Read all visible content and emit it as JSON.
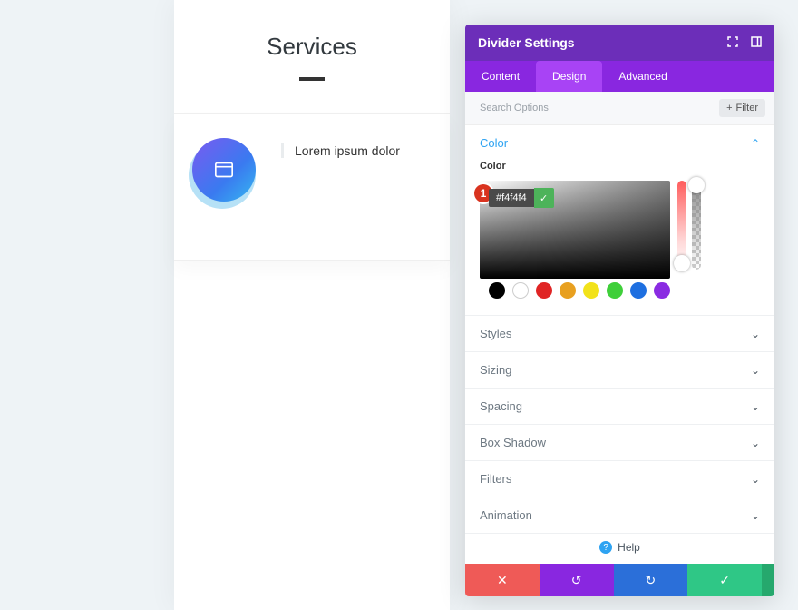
{
  "preview": {
    "title": "Services",
    "card_text": "Lorem ipsum dolor"
  },
  "settings": {
    "title": "Divider Settings",
    "tabs": {
      "content": "Content",
      "design": "Design",
      "advanced": "Advanced"
    },
    "search_placeholder": "Search Options",
    "filter_label": "Filter",
    "sections": {
      "color": "Color",
      "styles": "Styles",
      "sizing": "Sizing",
      "spacing": "Spacing",
      "box_shadow": "Box Shadow",
      "filters": "Filters",
      "animation": "Animation"
    },
    "color": {
      "sublabel": "Color",
      "hex": "#f4f4f4",
      "badge": "1",
      "swatches": [
        "#000000",
        "#ffffff",
        "#e02424",
        "#e8a020",
        "#f2e21a",
        "#3fcf3a",
        "#1e6fe0",
        "#8a2be2"
      ]
    },
    "help": "Help"
  }
}
